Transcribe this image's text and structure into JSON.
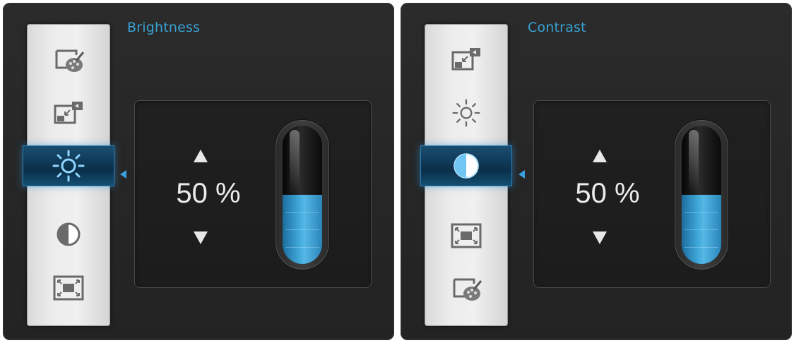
{
  "panels": [
    {
      "title": "Brightness",
      "value": "50 %",
      "level_percent": 50,
      "menu_items": [
        {
          "icon": "color-palette-icon",
          "selected": false
        },
        {
          "icon": "picture-in-picture-icon",
          "selected": false
        },
        {
          "icon": "brightness-sun-icon",
          "selected": true
        },
        {
          "icon": "contrast-icon",
          "selected": false
        },
        {
          "icon": "aspect-ratio-icon",
          "selected": false
        }
      ]
    },
    {
      "title": "Contrast",
      "value": "50 %",
      "level_percent": 50,
      "menu_items": [
        {
          "icon": "picture-in-picture-icon",
          "selected": false
        },
        {
          "icon": "brightness-sun-icon",
          "selected": false
        },
        {
          "icon": "contrast-icon",
          "selected": true
        },
        {
          "icon": "aspect-ratio-icon",
          "selected": false
        },
        {
          "icon": "color-palette-icon",
          "selected": false
        }
      ]
    }
  ],
  "colors": {
    "accent": "#39a3d6",
    "panel_background": "#262626",
    "menu_background": "#ececec",
    "selected_item": "#0f3a59",
    "level_fill": "#3fa6d8",
    "value_text": "#ececec"
  }
}
